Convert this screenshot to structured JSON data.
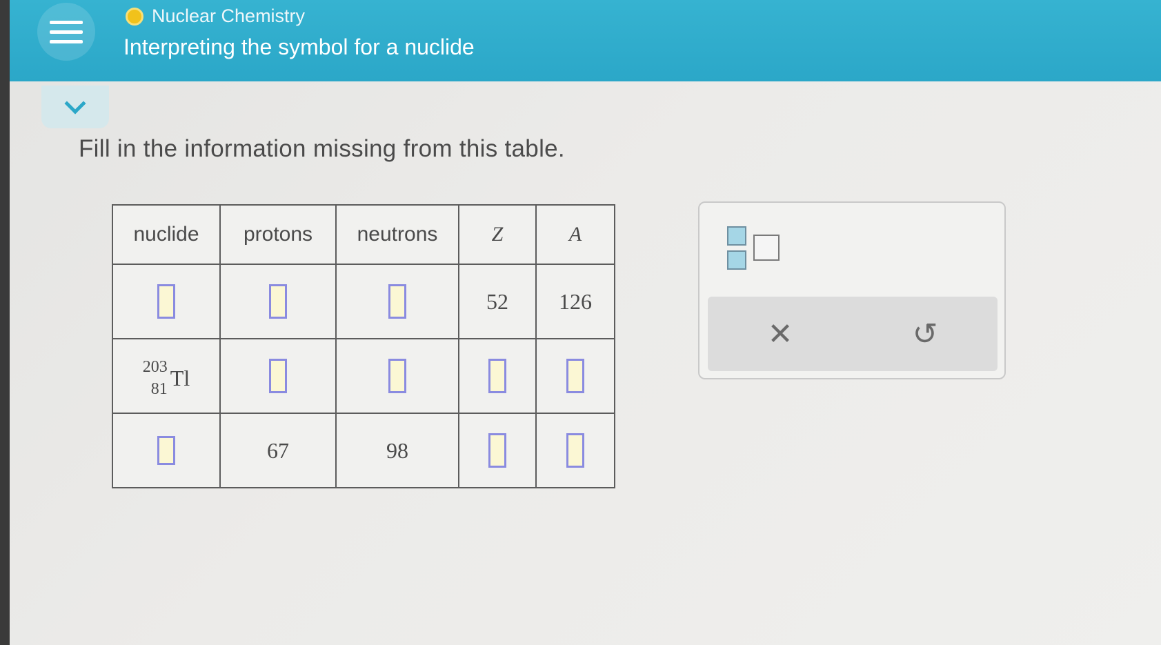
{
  "header": {
    "topic": "Nuclear Chemistry",
    "title": "Interpreting the symbol for a nuclide"
  },
  "prompt": "Fill in the information missing from this table.",
  "table": {
    "headers": [
      "nuclide",
      "protons",
      "neutrons",
      "Z",
      "A"
    ],
    "rows": [
      {
        "nuclide": null,
        "protons": null,
        "neutrons": null,
        "Z": "52",
        "A": "126"
      },
      {
        "nuclide": {
          "mass": "203",
          "atomic": "81",
          "symbol": "Tl"
        },
        "protons": null,
        "neutrons": null,
        "Z": null,
        "A": null
      },
      {
        "nuclide": null,
        "protons": "67",
        "neutrons": "98",
        "Z": null,
        "A": null
      }
    ]
  },
  "palette": {
    "clear_icon": "close-icon",
    "undo_icon": "undo-icon",
    "clear_glyph": "✕",
    "undo_glyph": "↺"
  },
  "colors": {
    "header": "#2ba7c8",
    "topic_dot": "#f1c21b",
    "input_border": "#8a8be0",
    "input_fill": "#fbf7d4"
  }
}
